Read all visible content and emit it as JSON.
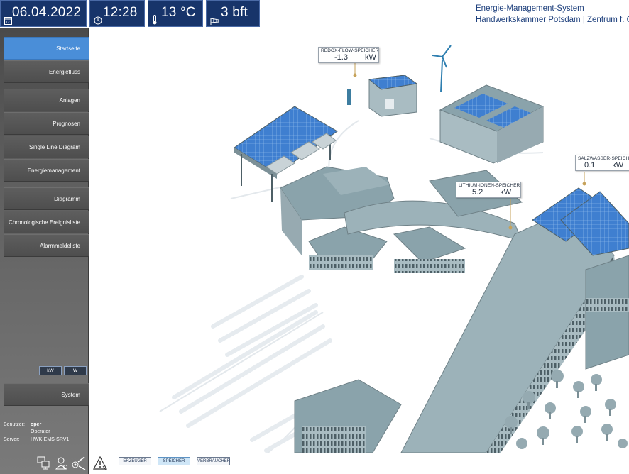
{
  "header": {
    "date": "06.04.2022",
    "time": "12:28",
    "temperature": "13 °C",
    "wind": "3 bft",
    "system_title": "Energie-Management-System",
    "system_subtitle": "Handwerkskammer Potsdam | Zentrum f. Gew",
    "icons": [
      "calendar-icon",
      "clock-icon",
      "thermometer-icon",
      "wind-sock-icon"
    ]
  },
  "sidebar": {
    "items": [
      {
        "label": "Startseite",
        "active": true
      },
      {
        "label": "Energiefluss",
        "active": false
      },
      {
        "label": "Anlagen",
        "active": false
      },
      {
        "label": "Prognosen",
        "active": false
      },
      {
        "label": "Single Line Diagram",
        "active": false
      },
      {
        "label": "Energiemanagement",
        "active": false
      },
      {
        "label": "Diagramm",
        "active": false
      },
      {
        "label": "Chronologische Ereignisliste",
        "active": false
      },
      {
        "label": "Alarmmeldeliste",
        "active": false
      }
    ],
    "units": {
      "kw": "kW",
      "w": "W"
    },
    "system_label": "System",
    "user": {
      "user_label": "Benutzer:",
      "user_name": "oper",
      "role": "Operator",
      "server_label": "Server:",
      "server_name": "HWK-EMS-SRV1"
    },
    "bottom_icons": [
      "computers-icon",
      "user-icon",
      "tools-icon"
    ]
  },
  "filters": {
    "erzeuger": "ERZEUGER",
    "speicher": "SPEICHER",
    "verbraucher": "VERBRAUCHER",
    "active": "speicher",
    "alarm_icon": "warning-triangle-icon"
  },
  "callouts": {
    "redox": {
      "title": "REDOX-FLOW-SPEICHER",
      "value": "-1.3",
      "unit": "kW"
    },
    "lithium": {
      "title": "LITHIUM-IONEN-SPEICHER",
      "value": "5.2",
      "unit": "kW"
    },
    "salz": {
      "title": "SALZWASSER-SPEICHE",
      "value": "0.1",
      "unit": "kW"
    }
  },
  "colors": {
    "header_tile": "#17346a",
    "active_nav": "#4a8ed8",
    "roof": "#8aa3ab",
    "wall": "#a9bcc2",
    "solar": "#3f7fd0"
  }
}
